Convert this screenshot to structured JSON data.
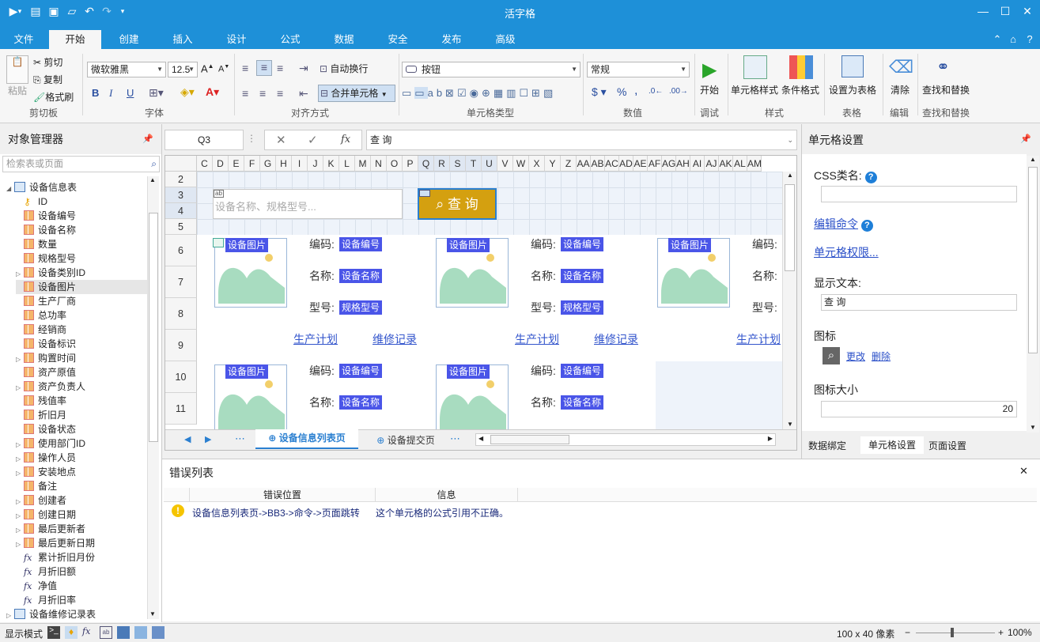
{
  "title": "活字格",
  "ribbon_tabs": [
    "文件",
    "开始",
    "创建",
    "插入",
    "设计",
    "公式",
    "数据",
    "安全",
    "发布",
    "高级"
  ],
  "active_tab": "开始",
  "clipboard": {
    "paste": "粘贴",
    "cut": "剪切",
    "copy": "复制",
    "format_painter": "格式刷",
    "group": "剪切板"
  },
  "font": {
    "family": "微软雅黑",
    "size": "12.5",
    "bold": "B",
    "italic": "I",
    "underline": "U",
    "group": "字体"
  },
  "align": {
    "wrap": "自动换行",
    "merge": "合并单元格",
    "group": "对齐方式"
  },
  "cell_type": {
    "selected": "按钮",
    "group": "单元格类型"
  },
  "number": {
    "format": "常规",
    "currency": "$",
    "percent": "%",
    "comma": ",",
    "group": "数值"
  },
  "debug": {
    "start": "开始",
    "group": "调试"
  },
  "style": {
    "cell_style": "单元格样式",
    "cond_format": "条件格式",
    "group": "样式"
  },
  "table": {
    "set_table": "设置为表格",
    "group": "表格"
  },
  "edit": {
    "clear": "清除",
    "group": "编辑"
  },
  "find": {
    "find_replace": "查找和替换",
    "group": "查找和替换"
  },
  "object_manager": {
    "title": "对象管理器",
    "search_placeholder": "检索表或页面",
    "items": [
      {
        "label": "设备信息表",
        "type": "table",
        "level": 0,
        "expanded": true
      },
      {
        "label": "ID",
        "type": "key",
        "level": 1
      },
      {
        "label": "设备编号",
        "type": "field",
        "level": 1
      },
      {
        "label": "设备名称",
        "type": "field",
        "level": 1
      },
      {
        "label": "数量",
        "type": "field",
        "level": 1
      },
      {
        "label": "规格型号",
        "type": "field",
        "level": 1
      },
      {
        "label": "设备类别ID",
        "type": "field",
        "level": 1,
        "collapsed": true
      },
      {
        "label": "设备图片",
        "type": "field",
        "level": 1,
        "selected": true
      },
      {
        "label": "生产厂商",
        "type": "field",
        "level": 1
      },
      {
        "label": "总功率",
        "type": "field",
        "level": 1
      },
      {
        "label": "经销商",
        "type": "field",
        "level": 1
      },
      {
        "label": "设备标识",
        "type": "field",
        "level": 1
      },
      {
        "label": "购置时间",
        "type": "field",
        "level": 1,
        "collapsed": true
      },
      {
        "label": "资产原值",
        "type": "field",
        "level": 1
      },
      {
        "label": "资产负责人",
        "type": "field",
        "level": 1,
        "collapsed": true
      },
      {
        "label": "残值率",
        "type": "field",
        "level": 1
      },
      {
        "label": "折旧月",
        "type": "field",
        "level": 1
      },
      {
        "label": "设备状态",
        "type": "field",
        "level": 1
      },
      {
        "label": "使用部门ID",
        "type": "field",
        "level": 1,
        "collapsed": true
      },
      {
        "label": "操作人员",
        "type": "field",
        "level": 1,
        "collapsed": true
      },
      {
        "label": "安装地点",
        "type": "field",
        "level": 1,
        "collapsed": true
      },
      {
        "label": "备注",
        "type": "field",
        "level": 1
      },
      {
        "label": "创建者",
        "type": "field",
        "level": 1,
        "collapsed": true
      },
      {
        "label": "创建日期",
        "type": "field",
        "level": 1,
        "collapsed": true
      },
      {
        "label": "最后更新者",
        "type": "field",
        "level": 1,
        "collapsed": true
      },
      {
        "label": "最后更新日期",
        "type": "field",
        "level": 1,
        "collapsed": true
      },
      {
        "label": "累计折旧月份",
        "type": "fx",
        "level": 1
      },
      {
        "label": "月折旧额",
        "type": "fx",
        "level": 1
      },
      {
        "label": "净值",
        "type": "fx",
        "level": 1
      },
      {
        "label": "月折旧率",
        "type": "fx",
        "level": 1
      },
      {
        "label": "设备维修记录表",
        "type": "table",
        "level": 0,
        "collapsed": true
      }
    ]
  },
  "formula": {
    "cell_ref": "Q3",
    "value": "查 询",
    "fx": "fx"
  },
  "columns": [
    "C",
    "D",
    "E",
    "F",
    "G",
    "H",
    "I",
    "J",
    "K",
    "L",
    "M",
    "N",
    "O",
    "P",
    "Q",
    "R",
    "S",
    "T",
    "U",
    "V",
    "W",
    "X",
    "Y",
    "Z",
    "AA",
    "AB",
    "AC",
    "AD",
    "AE",
    "AF",
    "AG",
    "AH",
    "AI",
    "AJ",
    "AK",
    "AL",
    "AM"
  ],
  "rows": [
    "2",
    "3",
    "4",
    "5",
    "6",
    "7",
    "8",
    "9",
    "10",
    "11"
  ],
  "sheet": {
    "search_placeholder": "设备名称、规格型号...",
    "search_button": "查 询",
    "image_tag": "设备图片",
    "code_label": "编码:",
    "name_label": "名称:",
    "model_label": "型号:",
    "code_tag": "设备编号",
    "name_tag": "设备名称",
    "model_tag": "规格型号",
    "plan_link": "生产计划",
    "repair_link": "维修记录"
  },
  "sheet_tabs": [
    "设备信息列表页",
    "设备提交页"
  ],
  "active_sheet_tab": "设备信息列表页",
  "cell_settings": {
    "title": "单元格设置",
    "css_label": "CSS类名:",
    "css_value": "",
    "edit_command": "编辑命令",
    "permissions": "单元格权限...",
    "display_text_label": "显示文本:",
    "display_text": "查 询",
    "icon_label": "图标",
    "change": "更改",
    "delete": "删除",
    "icon_size_label": "图标大小",
    "icon_size": "20",
    "tabs": [
      "数据绑定",
      "单元格设置",
      "页面设置"
    ],
    "active_tab": "单元格设置"
  },
  "errors": {
    "title": "错误列表",
    "col_position": "错误位置",
    "col_info": "信息",
    "rows": [
      {
        "position": "设备信息列表页->BB3->命令->页面跳转",
        "info": "这个单元格的公式引用不正确。"
      }
    ]
  },
  "status": {
    "mode": "显示模式",
    "size": "100 x 40 像素",
    "zoom": "100%"
  },
  "colors": {
    "accent": "#1e90d8",
    "tag": "#4a55e8",
    "button": "#d4a010"
  }
}
